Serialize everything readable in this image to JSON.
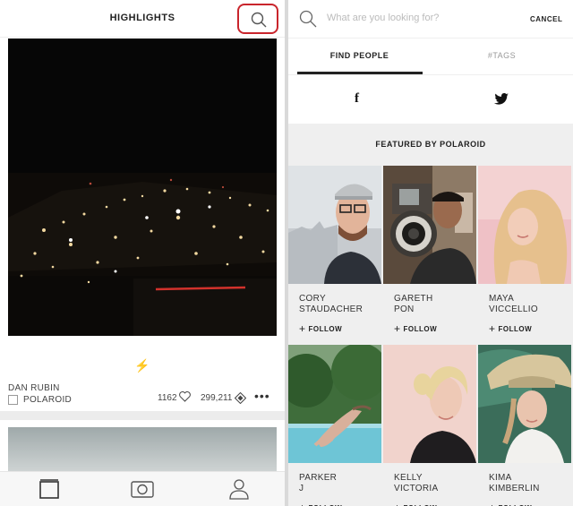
{
  "left": {
    "header_title": "HIGHLIGHTS",
    "post": {
      "author": "DAN RUBIN",
      "source": "POLAROID",
      "likes": "1162",
      "views": "299,211"
    }
  },
  "right": {
    "search_placeholder": "What are you looking for?",
    "cancel_label": "CANCEL",
    "tabs": [
      "FIND PEOPLE",
      "#TAGS"
    ],
    "featured_heading": "FEATURED BY POLAROID",
    "follow_label": "FOLLOW",
    "people": [
      {
        "first": "CORY",
        "last": "STAUDACHER"
      },
      {
        "first": "GARETH",
        "last": "PON"
      },
      {
        "first": "MAYA",
        "last": "VICCELLIO"
      },
      {
        "first": "PARKER",
        "last": "J"
      },
      {
        "first": "KELLY",
        "last": "VICTORIA"
      },
      {
        "first": "KIMA",
        "last": "KIMBERLIN"
      }
    ]
  },
  "colors": {
    "highlight_ring": "#c9252c",
    "bolt": "#e3b50a"
  },
  "icons": [
    "search-icon",
    "bolt-icon",
    "heart-icon",
    "diamond-icon",
    "more-icon",
    "feed-tab-icon",
    "camera-tab-icon",
    "profile-tab-icon",
    "facebook-icon",
    "twitter-icon"
  ]
}
